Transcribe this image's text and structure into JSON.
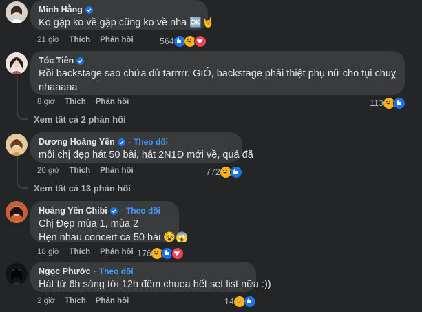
{
  "colors": {
    "background": "#242526",
    "bubble": "#3a3b3c",
    "follow": "#4599ff",
    "like": "#1b74e4",
    "love": "#f33e58",
    "haha": "#f7b125"
  },
  "actions": {
    "like": "Thích",
    "reply": "Phản hồi",
    "follow": "Theo dõi"
  },
  "comments": [
    {
      "name": "Minh Hằng",
      "text": [
        "Ko gặp ko về gặp cũng ko về nha 🆗🤘"
      ],
      "time": "21 giờ",
      "reactions": {
        "count": "564",
        "icons": [
          "like-icon",
          "haha-icon",
          "love-icon"
        ]
      },
      "verified": true,
      "follow": false
    },
    {
      "name": "Tóc Tiên",
      "text": [
        "Rồi backstage sao chứa đủ tarrrrr. GIÓ, backstage phải thiệt phụ nữ cho tụi chuỵ",
        "nhaaaaa"
      ],
      "time": "8 giờ",
      "reactions": {
        "count": "113",
        "icons": [
          "haha-icon",
          "like-icon"
        ]
      },
      "verified": true,
      "follow": false,
      "replies": "Xem tất cả 2 phản hồi"
    },
    {
      "name": "Dương Hoàng Yến",
      "text": [
        "mỗi chị đẹp hát 50 bài, hát 2N1Đ mới về, quá đã"
      ],
      "time": "20 giờ",
      "reactions": {
        "count": "772",
        "icons": [
          "haha-icon",
          "like-icon"
        ]
      },
      "verified": true,
      "follow": true,
      "replies": "Xem tất cả 13 phản hồi"
    },
    {
      "name": "Hoàng Yến Chibi",
      "text": [
        "Chị Đẹp mùa 1, mùa 2",
        "Hẹn nhau concert ca 50 bài 😵😱"
      ],
      "time": "18 giờ",
      "reactions": {
        "count": "176",
        "icons": [
          "haha-icon",
          "like-icon",
          "love-icon"
        ]
      },
      "verified": true,
      "follow": true
    },
    {
      "name": "Ngọc Phước",
      "text": [
        "Hát từ 6h sáng tới 12h đêm chuea hết set list nữa :))"
      ],
      "time": "2 giờ",
      "reactions": {
        "count": "14",
        "icons": [
          "haha-icon",
          "like-icon"
        ]
      },
      "verified": false,
      "follow": true
    }
  ]
}
